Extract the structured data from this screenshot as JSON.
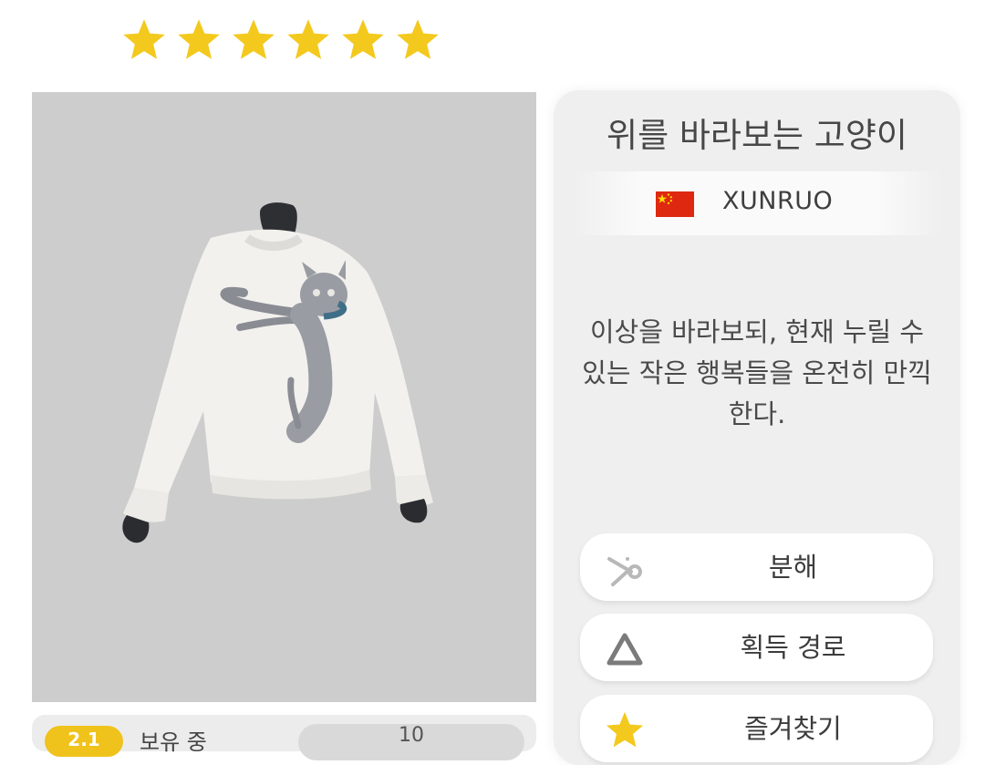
{
  "rating": {
    "stars": 6,
    "max_stars": 6,
    "star_color": "#f4c91e"
  },
  "preview": {
    "background": "#cdcdcd",
    "image": "white-cat-sweater"
  },
  "owned": {
    "badge": "2.1",
    "label": "보유 중",
    "count": "10"
  },
  "item": {
    "title": "위를 바라보는 고양이",
    "designer": {
      "flag": "china-flag",
      "name": "XUNRUO"
    },
    "description": "이상을 바라보되, 현재 누릴 수 있는 작은 행복들을 온전히 만끽한다."
  },
  "actions": [
    {
      "icon": "scissors-icon",
      "label": "분해"
    },
    {
      "icon": "triangle-icon",
      "label": "획득 경로"
    },
    {
      "icon": "star-icon",
      "label": "즐겨찾기"
    }
  ]
}
